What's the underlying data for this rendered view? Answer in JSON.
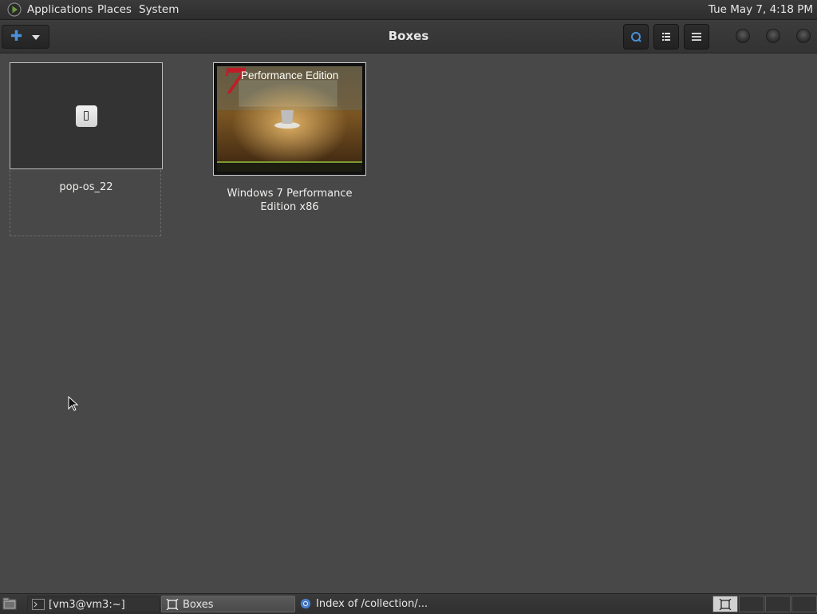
{
  "top_panel": {
    "menus": [
      "Applications",
      "Places",
      "System"
    ],
    "clock": "Tue May  7,  4:18 PM"
  },
  "headerbar": {
    "title": "Boxes",
    "new_button_icon": "plus-icon",
    "buttons": [
      "search-icon",
      "list-view-icon",
      "menu-icon"
    ],
    "window_controls": [
      "minimize",
      "maximize",
      "close"
    ]
  },
  "boxes": [
    {
      "name": "pop-os_22",
      "thumbnail_icon": "device-icon"
    },
    {
      "name": "Windows 7 Performance Edition x86",
      "name_line1": "Windows 7 Performance",
      "name_line2": "Edition x86",
      "thumbnail": {
        "big_numeral": "7",
        "title": "Performance Edition"
      }
    }
  ],
  "taskbar": {
    "tasks": [
      {
        "label": "[vm3@vm3:~]",
        "icon": "terminal-icon",
        "active": false
      },
      {
        "label": "Boxes",
        "icon": "boxes-icon",
        "active": true
      },
      {
        "label": "Index of /collection/...",
        "icon": "browser-icon",
        "active": false
      }
    ],
    "workspaces": 4,
    "active_workspace": 1
  },
  "colors": {
    "background": "#484848",
    "accent": "#4a90d9",
    "win7_red": "#c01c28"
  }
}
